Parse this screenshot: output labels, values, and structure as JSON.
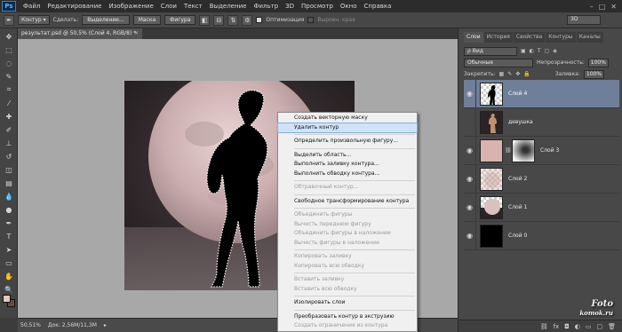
{
  "app": {
    "logo": "Ps"
  },
  "menubar": {
    "items": [
      "Файл",
      "Редактирование",
      "Изображение",
      "Слои",
      "Текст",
      "Выделение",
      "Фильтр",
      "3D",
      "Просмотр",
      "Окно",
      "Справка"
    ],
    "window_controls": [
      "–",
      "□",
      "✕"
    ]
  },
  "options": {
    "mode": "Контур",
    "make_label": "Сделать:",
    "selection_btn": "Выделение...",
    "mask_btn": "Маска",
    "shape_btn": "Фигура",
    "optimization_label": "Оптимизация",
    "align_edges_label": "Выровн. края",
    "workspace": "3D"
  },
  "document": {
    "tab_title": "результат.psd @ 50,5% (Слой 4, RGB/8) *",
    "tab_close": "×"
  },
  "status": {
    "zoom": "50,51%",
    "doc_info": "Док: 2,56M/11,3M"
  },
  "context_menu": {
    "items": [
      {
        "label": "Создать векторную маску",
        "enabled": true
      },
      {
        "label": "Удалить контур",
        "enabled": true,
        "highlighted": true
      },
      {
        "sep": true
      },
      {
        "label": "Определить произвольную фигуру...",
        "enabled": true
      },
      {
        "sep": true
      },
      {
        "label": "Выделить область...",
        "enabled": true
      },
      {
        "label": "Выполнить заливку контура...",
        "enabled": true
      },
      {
        "label": "Выполнить обводку контура...",
        "enabled": true
      },
      {
        "sep": true
      },
      {
        "label": "Обтравочный контур...",
        "enabled": false
      },
      {
        "sep": true
      },
      {
        "label": "Свободное трансформирование контура",
        "enabled": true
      },
      {
        "sep": true
      },
      {
        "label": "Объединить фигуры",
        "enabled": false
      },
      {
        "label": "Вычесть переднюю фигуру",
        "enabled": false
      },
      {
        "label": "Объединить фигуры в наложении",
        "enabled": false
      },
      {
        "label": "Вычесть фигуры в наложении",
        "enabled": false
      },
      {
        "sep": true
      },
      {
        "label": "Копировать заливку",
        "enabled": false
      },
      {
        "label": "Копировать всю обводку",
        "enabled": false
      },
      {
        "sep": true
      },
      {
        "label": "Вставить заливку",
        "enabled": false
      },
      {
        "label": "Вставить всю обводку",
        "enabled": false
      },
      {
        "sep": true
      },
      {
        "label": "Изолировать слои",
        "enabled": true
      },
      {
        "sep": true
      },
      {
        "label": "Преобразовать контур в экструзию",
        "enabled": true
      },
      {
        "label": "Создать ограничения из контура",
        "enabled": false
      }
    ]
  },
  "panel": {
    "tabs": [
      "Слои",
      "История",
      "Свойства",
      "Контуры",
      "Каналы"
    ],
    "active_tab": "Слои",
    "filter_kind": "ρ Вид",
    "blend_mode": "Обычные",
    "opacity_label": "Непрозрачность:",
    "opacity_value": "100%",
    "lock_label": "Закрепить:",
    "fill_label": "Заливка:",
    "fill_value": "100%",
    "layers": [
      {
        "name": "Слой 4",
        "selected": true,
        "visible": true,
        "thumb": "silhouette"
      },
      {
        "name": "девушка",
        "selected": false,
        "visible": false,
        "thumb": "girl"
      },
      {
        "name": "Слой 3",
        "selected": false,
        "visible": true,
        "thumb": "pink",
        "has_mask": true
      },
      {
        "name": "Слой 2",
        "selected": false,
        "visible": true,
        "thumb": "pink"
      },
      {
        "name": "Слой 1",
        "selected": false,
        "visible": true,
        "thumb": "moon"
      },
      {
        "name": "Слой 0",
        "selected": false,
        "visible": true,
        "thumb": "black"
      }
    ],
    "footer_icons": [
      "link-icon",
      "fx-icon",
      "mask-icon",
      "adjustment-icon",
      "folder-icon",
      "new-layer-icon",
      "trash-icon"
    ]
  },
  "watermark": {
    "line1": "Foto",
    "line2": "komok.ru"
  }
}
